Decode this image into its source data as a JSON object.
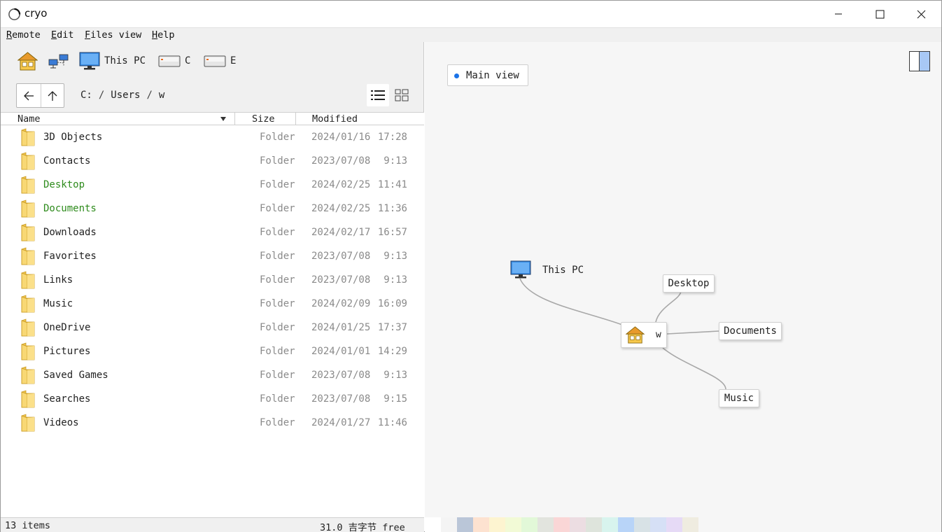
{
  "window": {
    "title": "cryo",
    "controls": {
      "minimize": "minimize-icon",
      "maximize": "maximize-icon",
      "close": "close-icon"
    }
  },
  "menu": [
    {
      "accel": "R",
      "rest": "emote"
    },
    {
      "accel": "E",
      "rest": "dit"
    },
    {
      "accel": "F",
      "rest": "iles view"
    },
    {
      "accel": "H",
      "rest": "elp"
    }
  ],
  "toolbar": {
    "home": "home-icon",
    "network": "network-icon",
    "this_pc": "This PC",
    "drive_c": "C",
    "drive_e": "E"
  },
  "breadcrumb": [
    "C:",
    "Users",
    "w"
  ],
  "breadcrumb_sep": "/",
  "columns": {
    "name": "Name",
    "size": "Size",
    "modified": "Modified"
  },
  "files": [
    {
      "name": "3D Objects",
      "size": "Folder",
      "date": "2024/01/16",
      "time": "17:28",
      "highlight": false
    },
    {
      "name": "Contacts",
      "size": "Folder",
      "date": "2023/07/08",
      "time": "9:13",
      "highlight": false
    },
    {
      "name": "Desktop",
      "size": "Folder",
      "date": "2024/02/25",
      "time": "11:41",
      "highlight": true
    },
    {
      "name": "Documents",
      "size": "Folder",
      "date": "2024/02/25",
      "time": "11:36",
      "highlight": true
    },
    {
      "name": "Downloads",
      "size": "Folder",
      "date": "2024/02/17",
      "time": "16:57",
      "highlight": false
    },
    {
      "name": "Favorites",
      "size": "Folder",
      "date": "2023/07/08",
      "time": "9:13",
      "highlight": false
    },
    {
      "name": "Links",
      "size": "Folder",
      "date": "2023/07/08",
      "time": "9:13",
      "highlight": false
    },
    {
      "name": "Music",
      "size": "Folder",
      "date": "2024/02/09",
      "time": "16:09",
      "highlight": false
    },
    {
      "name": "OneDrive",
      "size": "Folder",
      "date": "2024/01/25",
      "time": "17:37",
      "highlight": false
    },
    {
      "name": "Pictures",
      "size": "Folder",
      "date": "2024/01/01",
      "time": "14:29",
      "highlight": false
    },
    {
      "name": "Saved Games",
      "size": "Folder",
      "date": "2023/07/08",
      "time": "9:13",
      "highlight": false
    },
    {
      "name": "Searches",
      "size": "Folder",
      "date": "2023/07/08",
      "time": "9:15",
      "highlight": false
    },
    {
      "name": "Videos",
      "size": "Folder",
      "date": "2024/01/27",
      "time": "11:46",
      "highlight": false
    }
  ],
  "status": {
    "items": "13 items",
    "free": "31.0 吉字节 free"
  },
  "right": {
    "view_label": "Main view",
    "nodes": {
      "this_pc": "This PC",
      "center": "w",
      "desktop": "Desktop",
      "documents": "Documents",
      "music": "Music"
    }
  },
  "colors": {
    "highlight_text": "#2e8b1c",
    "accent": "#1a73e8",
    "palette": [
      "#ffffff",
      "#f4f4f4",
      "#bac6d8",
      "#fde2d0",
      "#fdf4d0",
      "#f2fad6",
      "#e2f8d8",
      "#e2e4de",
      "#fad6d6",
      "#ecdde2",
      "#dee4dc",
      "#d8f4ee",
      "#b8d4f8",
      "#d8e2e6",
      "#d6e0f6",
      "#e6daf6",
      "#efece0"
    ]
  }
}
